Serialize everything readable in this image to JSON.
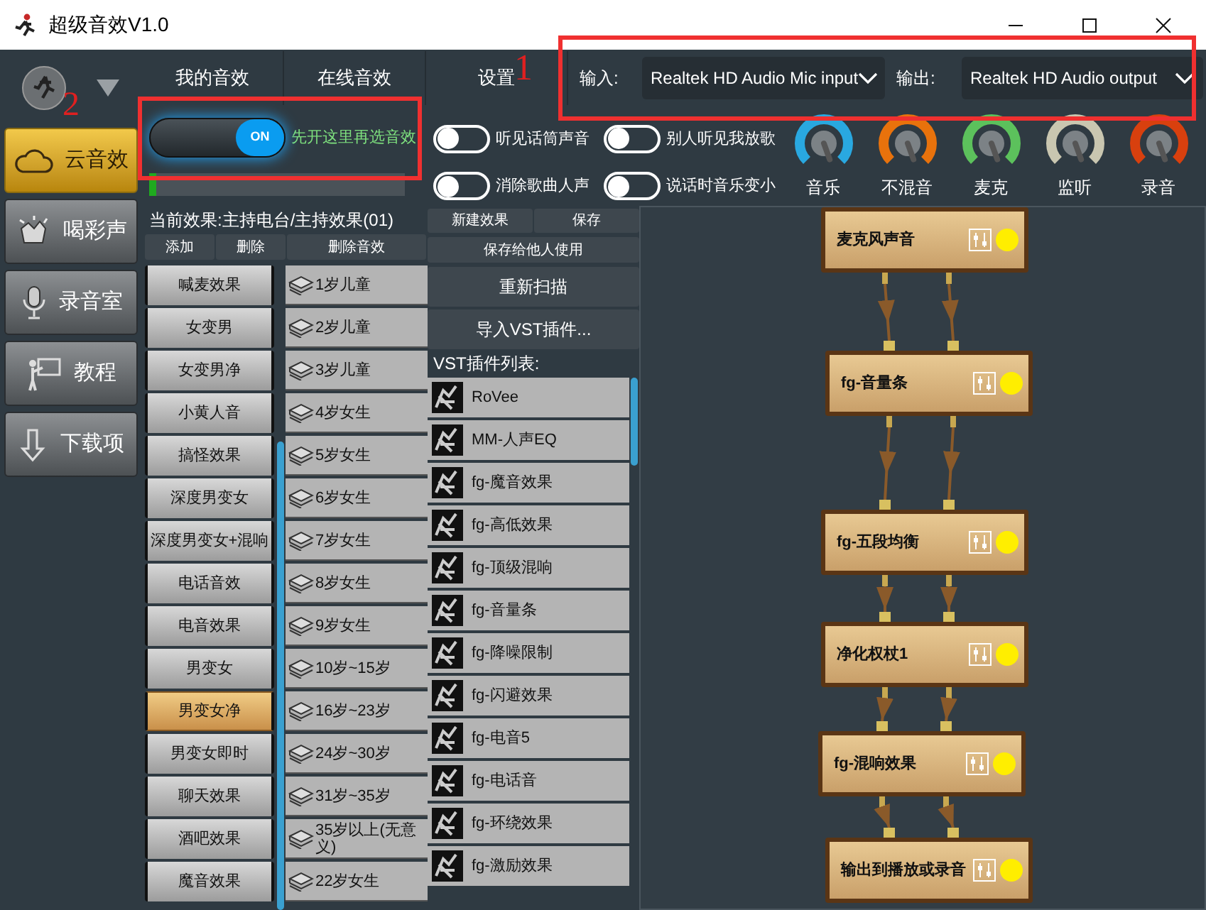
{
  "window": {
    "title": "超级音效V1.0"
  },
  "annotations": [
    {
      "text": "1"
    },
    {
      "text": "2"
    }
  ],
  "sidebar": {
    "items": [
      {
        "label": "云音效",
        "selected": true
      },
      {
        "label": "喝彩声",
        "selected": false
      },
      {
        "label": "录音室",
        "selected": false
      },
      {
        "label": "教程",
        "selected": false
      },
      {
        "label": "下载项",
        "selected": false
      }
    ]
  },
  "tabs": [
    {
      "label": "我的音效"
    },
    {
      "label": "在线音效"
    },
    {
      "label": "设置"
    }
  ],
  "devices": {
    "input_label": "输入:",
    "input_value": "Realtek HD Audio Mic input",
    "output_label": "输出:",
    "output_value": "Realtek HD Audio output"
  },
  "master_switch": {
    "on": true,
    "label": "ON",
    "hint": "先开这里再选音效"
  },
  "meter": {
    "level": 0.03
  },
  "options": [
    {
      "label": "听见话筒声音",
      "on": false
    },
    {
      "label": "别人听见我放歌",
      "on": false
    },
    {
      "label": "消除歌曲人声",
      "on": false
    },
    {
      "label": "说话时音乐变小",
      "on": false
    }
  ],
  "knobs": [
    {
      "label": "音乐",
      "color": "#29a8e0"
    },
    {
      "label": "不混音",
      "color": "#e8720c"
    },
    {
      "label": "麦克",
      "color": "#5cc15c"
    },
    {
      "label": "监听",
      "color": "#c9c6b0"
    },
    {
      "label": "录音",
      "color": "#d8400e"
    }
  ],
  "current_effect": "当前效果:主持电台/主持效果(01)",
  "effect_buttons": [
    "添加",
    "删除",
    "删除音效"
  ],
  "preset_buttons": [
    "新建效果",
    "保存"
  ],
  "share_button": "保存给他人使用",
  "rescan_button": "重新扫描",
  "import_button": "导入VST插件...",
  "effects": [
    {
      "label": "喊麦效果",
      "selected": false
    },
    {
      "label": "女变男",
      "selected": false
    },
    {
      "label": "女变男净",
      "selected": false
    },
    {
      "label": "小黄人音",
      "selected": false
    },
    {
      "label": "搞怪效果",
      "selected": false
    },
    {
      "label": "深度男变女",
      "selected": false
    },
    {
      "label": "深度男变女+混响",
      "selected": false
    },
    {
      "label": "电话音效",
      "selected": false
    },
    {
      "label": "电音效果",
      "selected": false
    },
    {
      "label": "男变女",
      "selected": false
    },
    {
      "label": "男变女净",
      "selected": true
    },
    {
      "label": "男变女即时",
      "selected": false
    },
    {
      "label": "聊天效果",
      "selected": false
    },
    {
      "label": "酒吧效果",
      "selected": false
    },
    {
      "label": "魔音效果",
      "selected": false
    }
  ],
  "voice_presets": [
    "1岁儿童",
    "2岁儿童",
    "3岁儿童",
    "4岁女生",
    "5岁女生",
    "6岁女生",
    "7岁女生",
    "8岁女生",
    "9岁女生",
    "10岁~15岁",
    "16岁~23岁",
    "24岁~30岁",
    "31岁~35岁",
    "35岁以上(无意义)",
    "22岁女生"
  ],
  "vst_list": {
    "title": "VST插件列表:",
    "items": [
      "RoVee",
      "MM-人声EQ",
      "fg-魔音效果",
      "fg-高低效果",
      "fg-顶级混响",
      "fg-音量条",
      "fg-降噪限制",
      "fg-闪避效果",
      "fg-电音5",
      "fg-电话音",
      "fg-环绕效果",
      "fg-激励效果"
    ]
  },
  "chain": {
    "nodes": [
      {
        "label": "麦克风声音"
      },
      {
        "label": "fg-音量条"
      },
      {
        "label": "fg-五段均衡"
      },
      {
        "label": "净化权杖1"
      },
      {
        "label": "fg-混响效果"
      },
      {
        "label": "输出到播放或录音"
      }
    ]
  }
}
